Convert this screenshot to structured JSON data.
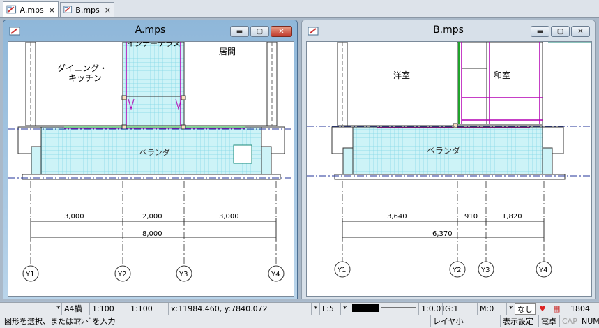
{
  "tabs": [
    {
      "label": "A.mps",
      "close": "×"
    },
    {
      "label": "B.mps",
      "close": "×"
    }
  ],
  "windowA": {
    "title": "A.mps",
    "rooms": {
      "dining_line1": "ダイニング・",
      "dining_line2": "キッチン",
      "partial": "インナーテラス",
      "living": "居間",
      "veranda": "ベランダ"
    },
    "dims_top": [
      "3,000",
      "2,000",
      "3,000"
    ],
    "dim_total": "8,000",
    "axes": [
      "Y1",
      "Y2",
      "Y3",
      "Y4"
    ]
  },
  "windowB": {
    "title": "B.mps",
    "rooms": {
      "yoshitsu": "洋室",
      "washitsu": "和室",
      "veranda": "ベランダ"
    },
    "dims_top": [
      "3,640",
      "910",
      "1,820"
    ],
    "dim_total": "6,370",
    "axes": [
      "Y1",
      "Y2",
      "Y3",
      "Y4"
    ]
  },
  "status1": {
    "star1": "*",
    "paper": "A4横",
    "scale1": "1:100",
    "scale2": "1:100",
    "coords": "x:11984.460, y:7840.072",
    "star2": "*",
    "layer": "L:5",
    "star3": "*",
    "ratio": "1:0.01",
    "group": "G:1",
    "mode": "M:0",
    "star4": "*",
    "nashi": "なし",
    "count": "1804"
  },
  "status2": {
    "prompt": "図形を選択、またはｺﾏﾝﾄﾞを入力",
    "layer_label": "レイヤ小",
    "display": "表示設定",
    "calc": "電卓",
    "cap": "CAP",
    "num": "NUM"
  },
  "colors": {
    "grid": "#7fd6e6",
    "fill": "#cdf3f7",
    "magenta": "#b300b3",
    "green": "#1fa32a"
  }
}
